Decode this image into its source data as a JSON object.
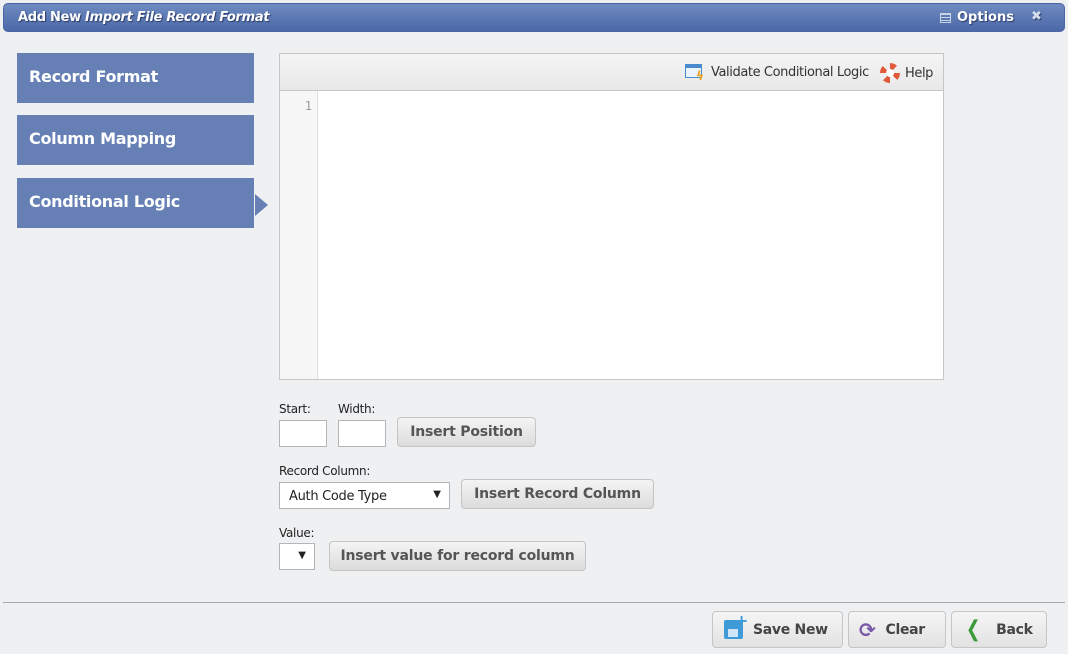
{
  "window": {
    "title_prefix": "Add New",
    "title_italic": "Import File Record Format",
    "options_label": "Options",
    "close_glyph": "✖"
  },
  "sidebar": {
    "items": [
      {
        "label": "Record Format",
        "active": false
      },
      {
        "label": "Column Mapping",
        "active": false
      },
      {
        "label": "Conditional Logic",
        "active": true
      }
    ]
  },
  "editor": {
    "toolbar": {
      "validate_label": "Validate Conditional Logic",
      "help_label": "Help"
    },
    "line_numbers": [
      "1"
    ],
    "content": ""
  },
  "form": {
    "start_label": "Start:",
    "start_value": "",
    "width_label": "Width:",
    "width_value": "",
    "insert_position_label": "Insert Position",
    "record_column_label": "Record Column:",
    "record_column_selected": "Auth Code Type",
    "insert_record_column_label": "Insert Record Column",
    "value_label": "Value:",
    "value_selected": "",
    "insert_value_label": "Insert value for record column",
    "dropdown_arrow": "▼"
  },
  "footer": {
    "save_new_label": "Save New",
    "clear_label": "Clear",
    "back_label": "Back"
  },
  "icons": {
    "validate": "validate-window-bolt-icon",
    "help": "lifebuoy-icon",
    "options": "list-icon",
    "close": "close-icon",
    "save_new": "save-new-icon",
    "clear": "refresh-icon",
    "back": "chevron-left-icon"
  },
  "colors": {
    "titlebar": "#4b68a8",
    "sidebar_item": "#6680b6",
    "background": "#eff0f2"
  }
}
